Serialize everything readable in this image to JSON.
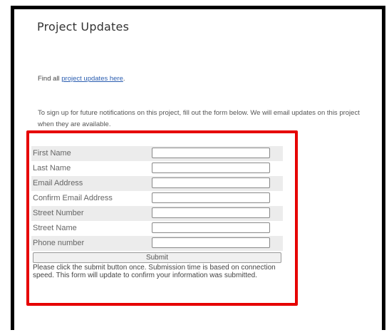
{
  "page": {
    "title": "Project Updates",
    "find_prefix": "Find all ",
    "find_link": "project updates here",
    "find_suffix": ".",
    "signup_text": "To sign up for future notifications on this project, fill out the form below. We will email updates on this project when they are available."
  },
  "form": {
    "fields": [
      {
        "label": "First Name",
        "value": ""
      },
      {
        "label": "Last Name",
        "value": ""
      },
      {
        "label": "Email Address",
        "value": ""
      },
      {
        "label": "Confirm Email Address",
        "value": ""
      },
      {
        "label": "Street Number",
        "value": ""
      },
      {
        "label": "Street Name",
        "value": ""
      },
      {
        "label": "Phone number",
        "value": ""
      }
    ],
    "submit_label": "Submit",
    "note": "Please click the submit button once.  Submission time is based on connection speed. This form will update to confirm your information was submitted."
  },
  "colors": {
    "highlight_border": "#e60000",
    "link": "#2a5db0"
  }
}
